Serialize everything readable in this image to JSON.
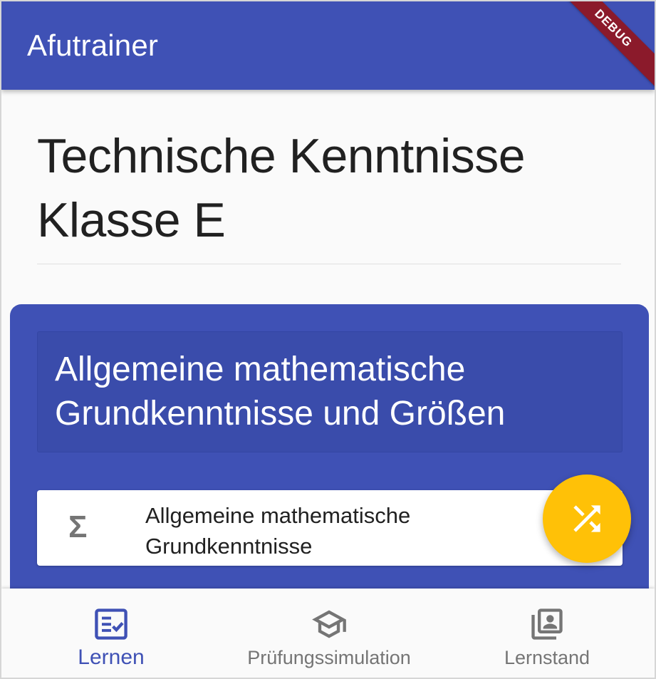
{
  "appbar": {
    "title": "Afutrainer",
    "debug_label": "DEBUG"
  },
  "page": {
    "title": "Technische Kenntnisse Klasse E"
  },
  "section": {
    "title": "Allgemeine mathematische Grundkenntnisse und Größen",
    "items": [
      {
        "label": "Allgemeine mathematische Grundkenntnisse",
        "icon": "sigma-icon",
        "icon_glyph": "Σ"
      }
    ]
  },
  "fab": {
    "icon": "shuffle-icon"
  },
  "bottom_nav": {
    "items": [
      {
        "label": "Lernen",
        "icon": "checklist-icon",
        "active": true
      },
      {
        "label": "Prüfungssimulation",
        "icon": "graduation-cap-icon",
        "active": false
      },
      {
        "label": "Lernstand",
        "icon": "portrait-library-icon",
        "active": false
      }
    ]
  },
  "colors": {
    "primary": "#3f51b5",
    "accent": "#ffc107",
    "debug_banner": "#8b1a2b",
    "inactive": "#757575"
  }
}
